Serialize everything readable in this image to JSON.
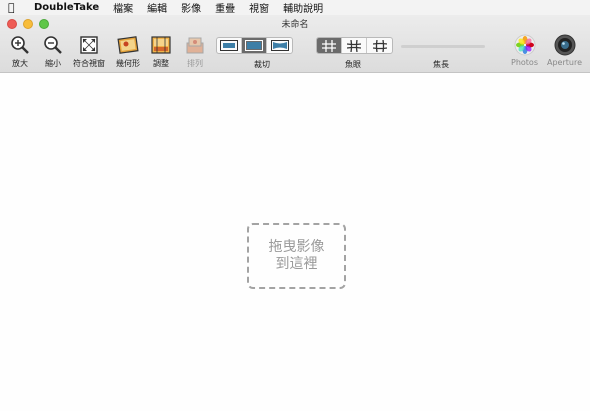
{
  "menubar": {
    "app_name": "DoubleTake",
    "items": [
      "檔案",
      "編輯",
      "影像",
      "重疊",
      "視窗",
      "輔助說明"
    ]
  },
  "window": {
    "title": "未命名"
  },
  "toolbar": {
    "zoom_in": "放大",
    "zoom_out": "縮小",
    "fit_window": "符合視窗",
    "geometry": "幾何形",
    "adjust": "調整",
    "arrange": "排列",
    "crop_label": "裁切",
    "fisheye_label": "魚眼",
    "focal_length_label": "焦長",
    "photos": "Photos",
    "aperture": "Aperture"
  },
  "dropzone": {
    "line1": "拖曳影像",
    "line2": "到這裡"
  },
  "colors": {
    "close": "#ee5c55",
    "minimize": "#f8bd3b",
    "zoom": "#5fc649",
    "segment_active": "#6b6b6b"
  }
}
